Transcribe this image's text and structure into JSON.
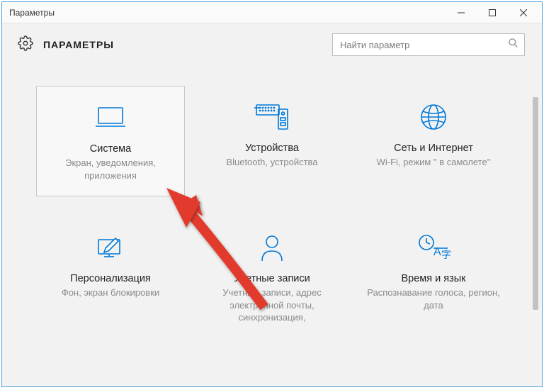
{
  "window": {
    "title": "Параметры"
  },
  "header": {
    "title": "ПАРАМЕТРЫ"
  },
  "search": {
    "placeholder": "Найти параметр"
  },
  "tiles": [
    {
      "id": "system",
      "title": "Система",
      "desc": "Экран, уведомления, приложения",
      "selected": true
    },
    {
      "id": "devices",
      "title": "Устройства",
      "desc": "Bluetooth, устройства",
      "selected": false
    },
    {
      "id": "network",
      "title": "Сеть и Интернет",
      "desc": "Wi-Fi, режим \" в самолете\"",
      "selected": false
    },
    {
      "id": "personalization",
      "title": "Персонализация",
      "desc": "Фон, экран блокировки",
      "selected": false
    },
    {
      "id": "accounts",
      "title": "Учетные записи",
      "desc": "Учетные записи, адрес электронной почты, синхронизация,",
      "selected": false
    },
    {
      "id": "time-language",
      "title": "Время и язык",
      "desc": "Распознавание голоса, регион, дата",
      "selected": false
    }
  ]
}
